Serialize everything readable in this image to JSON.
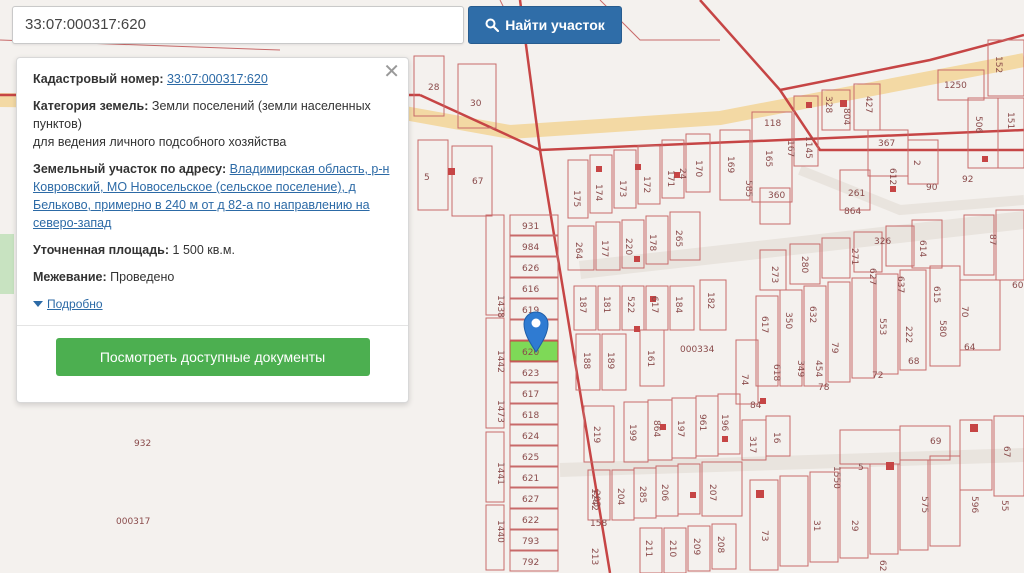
{
  "search": {
    "value": "33:07:000317:620",
    "button_label": "Найти участок"
  },
  "popup": {
    "cadastral_label": "Кадастровый номер:",
    "cadastral_value": "33:07:000317:620",
    "category_label": "Категория земель:",
    "category_value": "Земли поселений (земли населенных пунктов)",
    "category_use": "для ведения личного подсобного хозяйства",
    "address_label": "Земельный участок по адресу:",
    "address_value": "Владимирская область, р-н Ковровский, МО Новосельское (сельское поселение), д Бельково, примерно в 240 м от д 82-а по направлению на северо-запад",
    "area_label": "Уточненная площадь:",
    "area_value": "1 500 кв.м.",
    "survey_label": "Межевание:",
    "survey_value": "Проведено",
    "more_label": "Подробно",
    "docs_button": "Посмотреть доступные документы"
  },
  "map": {
    "quarter_labels": [
      "000317",
      "000334"
    ],
    "parcel_labels": {
      "left_column": [
        "931",
        "984",
        "626",
        "616",
        "619",
        "620",
        "623",
        "617",
        "618",
        "624",
        "625",
        "621",
        "627",
        "622",
        "793",
        "792"
      ],
      "left_side": [
        "1438",
        "1442",
        "1473",
        "1441",
        "1440",
        "1242",
        "158",
        "213"
      ],
      "top_left": [
        "28",
        "30",
        "5",
        "67",
        "932"
      ],
      "upper_middle": [
        "175",
        "174",
        "173",
        "172",
        "171",
        "24",
        "170",
        "169",
        "165",
        "118",
        "167",
        "1145",
        "328",
        "427",
        "804",
        "360",
        "585",
        "261",
        "864",
        "367",
        "2",
        "612",
        "90",
        "92",
        "1250",
        "506",
        "151",
        "152"
      ],
      "middle_row": [
        "264",
        "177",
        "220",
        "178",
        "265",
        "280",
        "271",
        "326",
        "614",
        "87",
        "273",
        "627",
        "637",
        "615",
        "70",
        "60",
        "64"
      ],
      "center": [
        "187",
        "181",
        "522",
        "617",
        "184",
        "182",
        "188",
        "189",
        "161",
        "617",
        "350",
        "632",
        "79",
        "553",
        "222",
        "580",
        "68",
        "618",
        "349",
        "454",
        "74",
        "84",
        "78",
        "72"
      ],
      "lower": [
        "219",
        "199",
        "864",
        "197",
        "961",
        "196",
        "317",
        "16",
        "69",
        "67",
        "203",
        "204",
        "285",
        "206",
        "207",
        "73",
        "31",
        "29",
        "1550",
        "575",
        "596",
        "55",
        "5",
        "211",
        "210",
        "209",
        "208",
        "62"
      ]
    },
    "selected_parcel": "620",
    "colors": {
      "selected_fill": "#7ed957",
      "pin": "#2f7bd2",
      "parcel_line": "#c64545"
    }
  }
}
